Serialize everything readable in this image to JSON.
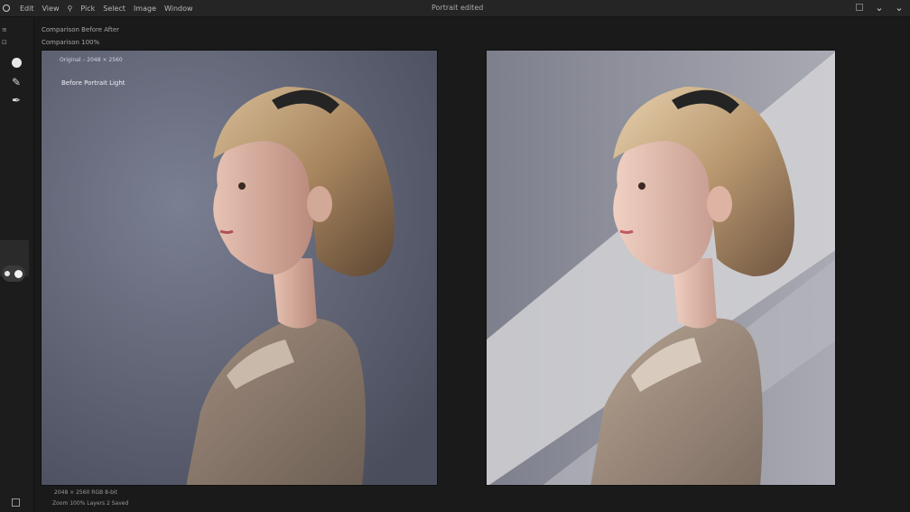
{
  "menubar": {
    "items": [
      "Edit",
      "View",
      "⚲",
      "Pick",
      "Select",
      "Image",
      "Window"
    ],
    "document_title": "Portrait edited"
  },
  "left_rail": {
    "labels": [
      "≡",
      "⊡",
      "Ⓧ"
    ]
  },
  "subheader": {
    "line1": "Comparison  Before  After",
    "line2": "Comparison  100%"
  },
  "canvas": {
    "left_overlay_top": "Original – 2048 × 2560",
    "left_overlay_title": "Before  Portrait Light"
  },
  "status": {
    "line1": "2048  ×  2560   RGB   8-bit",
    "line2": "Zoom  100%   Layers  2   Saved"
  },
  "icons": {
    "app": "app-logo-icon",
    "minimize": "chevron-down-icon",
    "menu": "chevron-down-icon"
  }
}
